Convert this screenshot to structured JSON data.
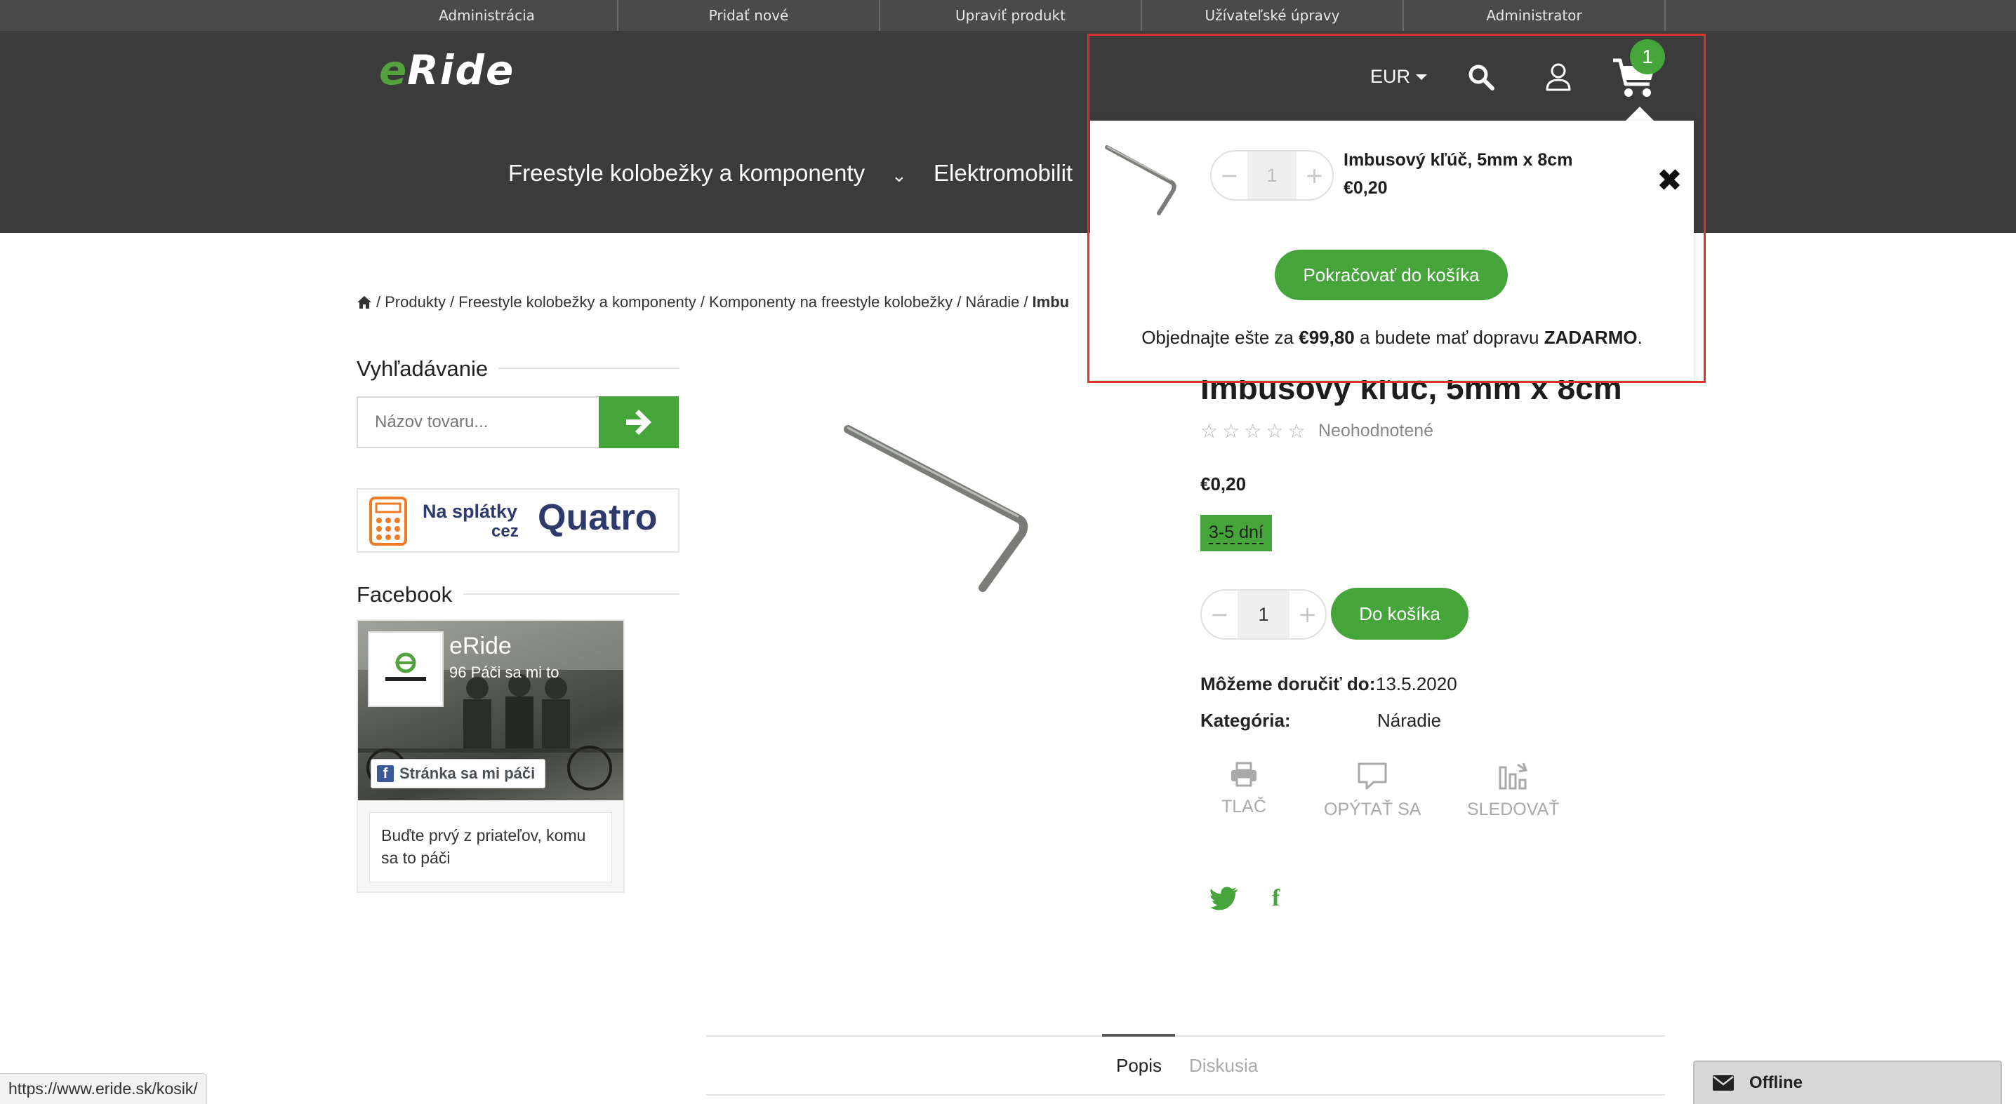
{
  "admin_bar": {
    "items": [
      "Administrácia",
      "Pridať nové",
      "Upraviť produkt",
      "Užívateľské úpravy",
      "Administrator"
    ]
  },
  "header": {
    "logo_text": "eRide",
    "nav": [
      "Freestyle kolobežky a komponenty",
      "Elektromobilit"
    ],
    "currency": "EUR",
    "cart_count": "1"
  },
  "breadcrumb": {
    "items": [
      "Produkty",
      "Freestyle kolobežky a komponenty",
      "Komponenty na freestyle kolobežky",
      "Náradie"
    ],
    "current": "Imbu",
    "separator": "/"
  },
  "sidebar": {
    "search_title": "Vyhľadávanie",
    "search_placeholder": "Názov tovaru...",
    "banner_text_1": "Na splátky",
    "banner_text_2": "cez",
    "banner_brand": "Quatro",
    "facebook_title": "Facebook",
    "fb_page_name": "eRide",
    "fb_likes": "96 Páči sa mi to",
    "fb_like_button": "Stránka sa mi páči",
    "fb_friends_text": "Buďte prvý z priateľov, komu sa to páči"
  },
  "product": {
    "title": "Imbusový kľúč, 5mm x 8cm",
    "stars": "☆☆☆☆☆",
    "rating_text": "Neohodnotené",
    "price": "€0,20",
    "availability": "3-5 dní",
    "quantity": "1",
    "add_to_cart": "Do košíka",
    "delivery_label": "Môžeme doručiť do:",
    "delivery_value": "13.5.2020",
    "category_label": "Kategória:",
    "category_value": "Náradie",
    "actions": [
      "TLAČ",
      "OPÝTAŤ SA",
      "SLEDOVAŤ"
    ]
  },
  "tabs": [
    "Popis",
    "Diskusia"
  ],
  "cart_dropdown": {
    "quantity": "1",
    "item_name": "Imbusový kľúč, 5mm x 8cm",
    "item_price": "€0,20",
    "continue_button": "Pokračovať do košíka",
    "promo_prefix": "Objednajte ešte za ",
    "promo_amount": "€99,80",
    "promo_middle": " a budete mať dopravu ",
    "promo_free": "ZADARMO",
    "promo_suffix": "."
  },
  "status_url": "https://www.eride.sk/kosik/",
  "chat": {
    "label": "Offline"
  },
  "colors": {
    "accent": "#45a53a",
    "header_bg": "#3b3b3b",
    "admin_bg": "#4a4a4a",
    "highlight": "#d8352a"
  }
}
